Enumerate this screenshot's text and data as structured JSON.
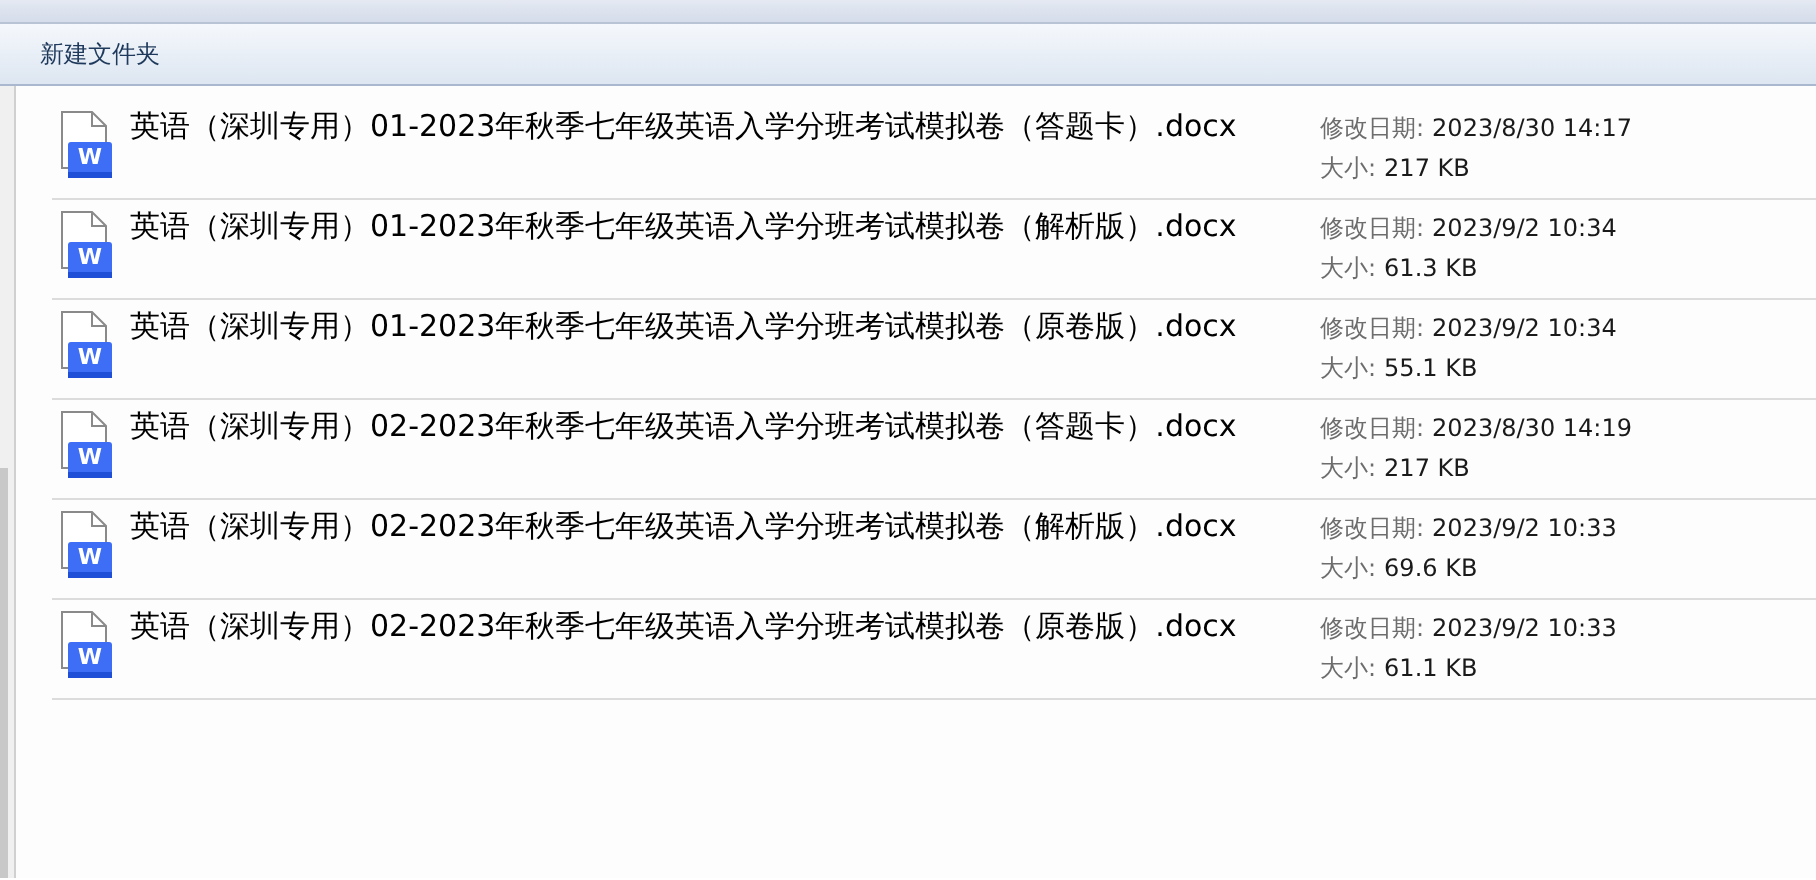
{
  "toolbar": {
    "new_folder": "新建文件夹"
  },
  "files": [
    {
      "name": "英语（深圳专用）01-2023年秋季七年级英语入学分班考试模拟卷（答题卡）.docx",
      "icon_letter": "W",
      "date_label": "修改日期:",
      "date": "2023/8/30 14:17",
      "size_label": "大小:",
      "size": "217 KB"
    },
    {
      "name": "英语（深圳专用）01-2023年秋季七年级英语入学分班考试模拟卷（解析版）.docx",
      "icon_letter": "W",
      "date_label": "修改日期:",
      "date": "2023/9/2 10:34",
      "size_label": "大小:",
      "size": "61.3 KB"
    },
    {
      "name": "英语（深圳专用）01-2023年秋季七年级英语入学分班考试模拟卷（原卷版）.docx",
      "icon_letter": "W",
      "date_label": "修改日期:",
      "date": "2023/9/2 10:34",
      "size_label": "大小:",
      "size": "55.1 KB"
    },
    {
      "name": "英语（深圳专用）02-2023年秋季七年级英语入学分班考试模拟卷（答题卡）.docx",
      "icon_letter": "W",
      "date_label": "修改日期:",
      "date": "2023/8/30 14:19",
      "size_label": "大小:",
      "size": "217 KB"
    },
    {
      "name": "英语（深圳专用）02-2023年秋季七年级英语入学分班考试模拟卷（解析版）.docx",
      "icon_letter": "W",
      "date_label": "修改日期:",
      "date": "2023/9/2 10:33",
      "size_label": "大小:",
      "size": "69.6 KB"
    },
    {
      "name": "英语（深圳专用）02-2023年秋季七年级英语入学分班考试模拟卷（原卷版）.docx",
      "icon_letter": "W",
      "date_label": "修改日期:",
      "date": "2023/9/2 10:33",
      "size_label": "大小:",
      "size": "61.1 KB"
    }
  ]
}
